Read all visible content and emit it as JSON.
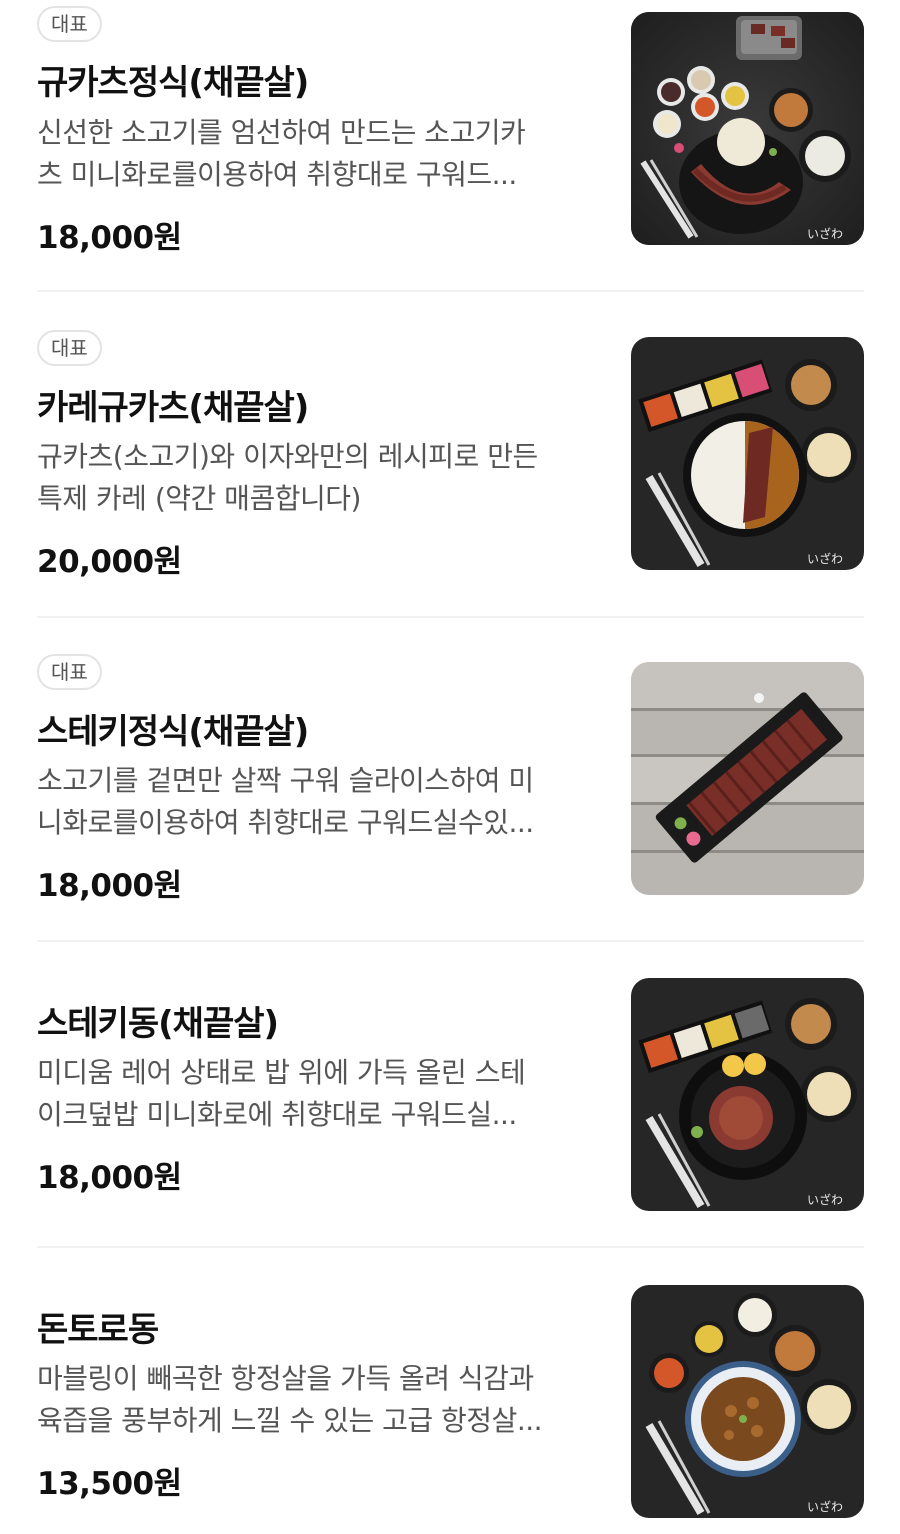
{
  "menu": {
    "items": [
      {
        "badge": "대표",
        "name": "규카츠정식(채끝살)",
        "desc_line1": "신선한 소고기를 엄선하여 만드는 소고기카",
        "desc_line2": "츠 미니화로를이용하여 취향대로 구워드...",
        "price": "18,000원",
        "image": "gyukatsu-set-photo"
      },
      {
        "badge": "대표",
        "name": "카레규카츠(채끝살)",
        "desc_line1": "규카츠(소고기)와 이자와만의 레시피로 만든",
        "desc_line2": "특제 카레 (약간 매콤합니다)",
        "price": "20,000원",
        "image": "curry-gyukatsu-photo"
      },
      {
        "badge": "대표",
        "name": "스테키정식(채끝살)",
        "desc_line1": "소고기를 겉면만 살짝 구워 슬라이스하여 미",
        "desc_line2": "니화로를이용하여 취향대로 구워드실수있...",
        "price": "18,000원",
        "image": "steak-set-photo"
      },
      {
        "name": "스테키동(채끝살)",
        "desc_line1": "미디움 레어 상태로 밥 위에 가득 올린 스테",
        "desc_line2": "이크덮밥 미니화로에 취향대로 구워드실...",
        "price": "18,000원",
        "image": "steak-don-photo"
      },
      {
        "name": "돈토로동",
        "desc_line1": "마블링이 빼곡한 항정살을 가득 올려 식감과",
        "desc_line2": "육즙을 풍부하게 느낄 수 있는 고급 항정살...",
        "price": "13,500원",
        "image": "tontoro-don-photo"
      }
    ],
    "watermark": "いざわ"
  }
}
